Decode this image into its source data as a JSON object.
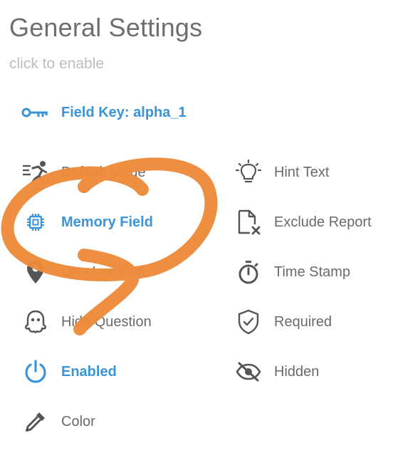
{
  "header": {
    "title": "General Settings",
    "subtitle": "click to enable"
  },
  "field_key": {
    "label": "Field Key: alpha_1",
    "icon": "key-icon"
  },
  "settings": [
    {
      "id": "default-value",
      "label": "Default Value",
      "icon": "running-figure-icon",
      "active": false
    },
    {
      "id": "hint-text",
      "label": "Hint Text",
      "icon": "lightbulb-icon",
      "active": false
    },
    {
      "id": "memory-field",
      "label": "Memory Field",
      "icon": "chip-icon",
      "active": true
    },
    {
      "id": "exclude-report",
      "label": "Exclude Report",
      "icon": "file-x-icon",
      "active": false
    },
    {
      "id": "geo-location",
      "label": "Geo Location",
      "icon": "map-pin-icon",
      "active": false
    },
    {
      "id": "time-stamp",
      "label": "Time Stamp",
      "icon": "stopwatch-icon",
      "active": false
    },
    {
      "id": "hide-question",
      "label": "Hide Question",
      "icon": "ghost-icon",
      "active": false
    },
    {
      "id": "required",
      "label": "Required",
      "icon": "shield-check-icon",
      "active": false
    },
    {
      "id": "enabled",
      "label": "Enabled",
      "icon": "power-icon",
      "active": true
    },
    {
      "id": "hidden",
      "label": "Hidden",
      "icon": "eye-off-icon",
      "active": false
    },
    {
      "id": "color",
      "label": "Color",
      "icon": "eyedropper-icon",
      "active": false
    }
  ],
  "colors": {
    "active": "#3b93d8",
    "inactive": "#6a6a6a",
    "title": "#6e6e6e",
    "subtitle": "#bdbdbd",
    "annotation": "#ec8a3a"
  }
}
